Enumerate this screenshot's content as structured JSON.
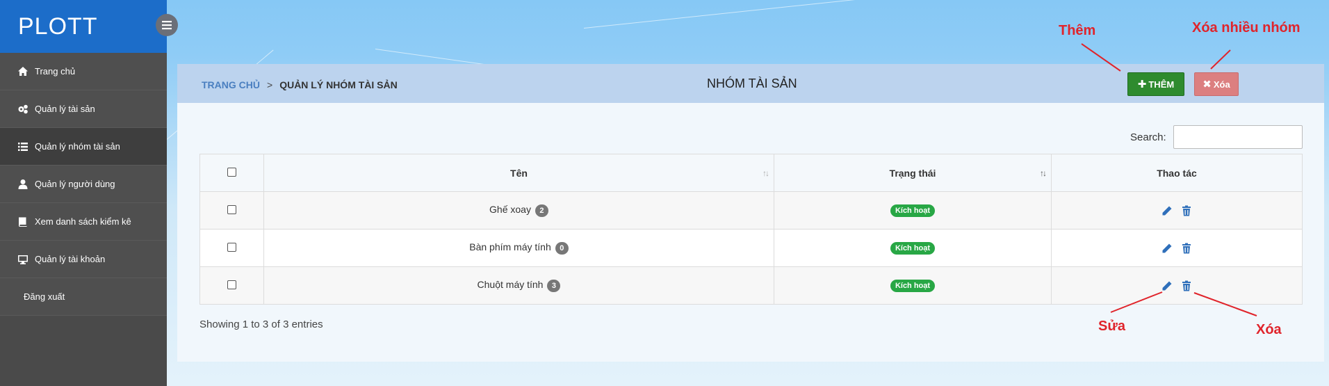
{
  "brand": {
    "title": "PLOTT"
  },
  "sidebar": {
    "items": [
      {
        "label": "Trang chủ",
        "icon": "home-icon"
      },
      {
        "label": "Quản lý tài sản",
        "icon": "gears-icon"
      },
      {
        "label": "Quản lý nhóm tài sản",
        "icon": "list-icon",
        "active": true
      },
      {
        "label": "Quản lý người dùng",
        "icon": "user-icon"
      },
      {
        "label": "Xem danh sách kiểm kê",
        "icon": "book-icon"
      },
      {
        "label": "Quản lý tài khoản",
        "icon": "monitor-icon"
      },
      {
        "label": "Đăng xuất",
        "icon": ""
      }
    ]
  },
  "breadcrumb": {
    "home": "TRANG CHỦ",
    "separator": ">",
    "current": "QUẢN LÝ NHÓM TÀI SẢN"
  },
  "page": {
    "title": "NHÓM TÀI SẢN"
  },
  "toolbar": {
    "add_label": "THÊM",
    "delete_label": "Xóa"
  },
  "search": {
    "label": "Search:",
    "value": ""
  },
  "table": {
    "headers": {
      "name": "Tên",
      "status": "Trạng thái",
      "actions": "Thao tác"
    },
    "rows": [
      {
        "name": "Ghế xoay",
        "count": "2",
        "status": "Kích hoạt"
      },
      {
        "name": "Bàn phím máy tính",
        "count": "0",
        "status": "Kích hoạt"
      },
      {
        "name": "Chuột máy tính",
        "count": "3",
        "status": "Kích hoạt"
      }
    ]
  },
  "footer": {
    "info": "Showing 1 to 3 of 3 entries"
  },
  "annotations": {
    "add": "Thêm",
    "delete_many": "Xóa nhiều nhóm",
    "edit": "Sửa",
    "delete": "Xóa"
  },
  "colors": {
    "brand": "#1c6dc9",
    "sidebar": "#4a4a4a",
    "add_button": "#2e8b2e",
    "delete_button": "#dc7f80",
    "status": "#28a745",
    "annotation": "#e0242b"
  }
}
